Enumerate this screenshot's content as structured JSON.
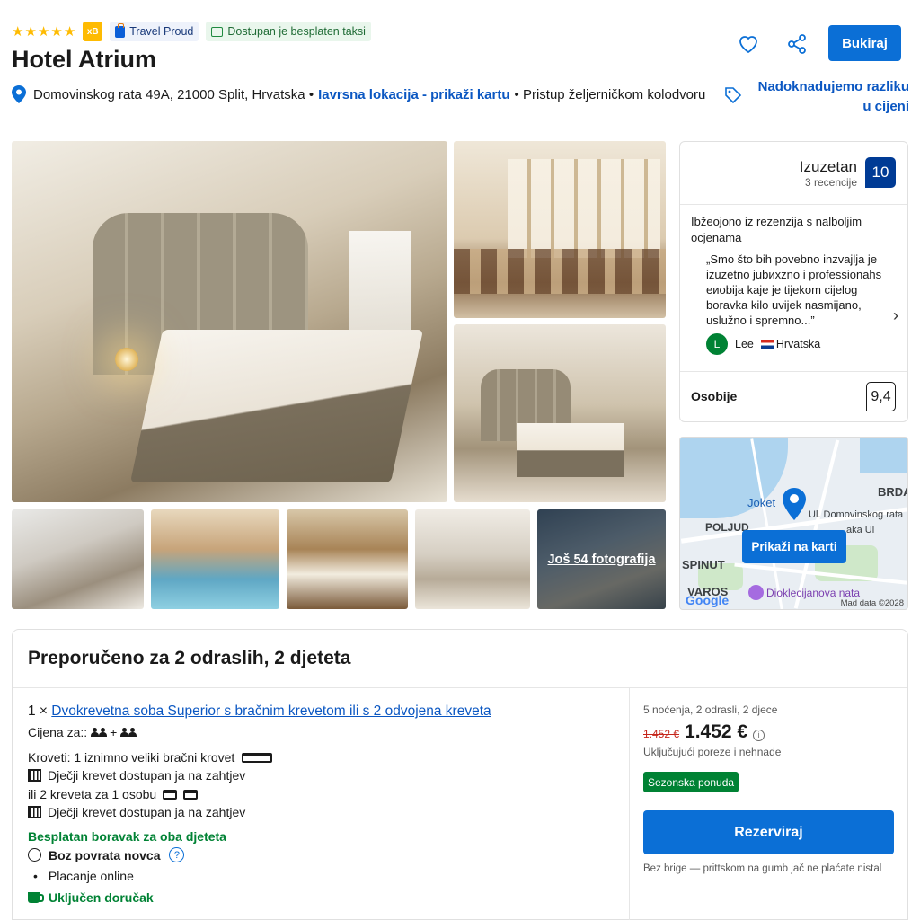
{
  "header": {
    "stars": 5,
    "rating_badge": "xB",
    "travel_proud": "Travel Proud",
    "taxi": "Dostupan je besplaten taksi",
    "title": "Hotel Atrium",
    "address": "Domovinskog rata 49A, 21000 Split, Hrvatska",
    "location_link": "Iavrsna lokacija - prikaži kartu",
    "station": "Pristup željerničkom kolodvoru",
    "book_button": "Bukiraj",
    "price_match": "Nadoknadujemo razliku u cijeni",
    "icons": [
      "heart-icon",
      "share-icon"
    ]
  },
  "gallery": {
    "more_photos": "Još 54 fotografija"
  },
  "review": {
    "label": "Izuzetan",
    "count": "3 recencije",
    "score": "10",
    "intro": "Ibžeojono iz rezenzija s nalboljim ocjenama",
    "quote": "„Smo što bih povebno inzvajlja je izuzetno jubиxzno i professionahs eиobija kaje je tijekom cijelog boravka kilo uvijek nasmijano, uslužno i spremno...”",
    "user_initial": "L",
    "user_name": "Lee",
    "user_country": "Hrvatska",
    "staff_label": "Osobije",
    "staff_score": "9,4"
  },
  "map": {
    "button": "Prikaži na karti",
    "labels": {
      "joket": "Joket",
      "brda": "BRDA",
      "street": "Ul. Domovinskog rata",
      "street2": "aka Ul",
      "poljud": "POLJUD",
      "spinut": "SPINUT",
      "varos": "VAROS",
      "poi": "Dioklecijanova nata",
      "google": "Google",
      "map_data": "Mad data ©2028"
    }
  },
  "reco": {
    "title": "Preporučeno za 2 odraslih, 2 djeteta",
    "room_prefix": "1 ×",
    "room_name": "Dvokrevetna soba Superior s bračnim krevetom ili s 2 odvojena kreveta",
    "price_for": "Cijena za::",
    "plus": "+",
    "beds1": "Kroveti: 1 iznimno veliki bračni krovet",
    "crib1": "Dječji krevet dostupan ja na zahtjev",
    "beds2": "ili 2 kreveta za 1 osobu",
    "crib2": "Dječji krevet dostupan ja na zahtjev",
    "kids_free": "Besplatan boravak za oba djeteta",
    "no_refund": "Boz povrata novca",
    "pay_online": "Placanje online",
    "breakfast": "Uključen doručak",
    "summary": "5 noćenja, 2 odrasli, 2 djece",
    "old_price": "1.452 €",
    "new_price": "1.452 €",
    "taxes": "Uključujući poreze i nehnade",
    "season": "Sezonska ponuda",
    "reserve": "Rezerviraj",
    "footnote": "Bez brige — prittskom na gumb jač ne plaćate nistal"
  },
  "colors": {
    "primary": "#0b6fd6",
    "link": "#0b57c2",
    "score_bg": "#003b95",
    "green": "#008234",
    "star": "#febb02"
  }
}
